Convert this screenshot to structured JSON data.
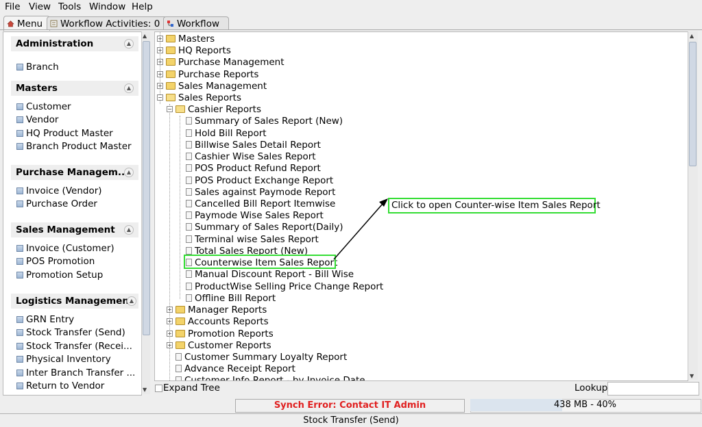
{
  "menubar": {
    "items": [
      "File",
      "View",
      "Tools",
      "Window",
      "Help"
    ]
  },
  "tabs": [
    {
      "label": "Menu",
      "icon": "home-icon"
    },
    {
      "label": "Workflow Activities: 0",
      "icon": "list-icon"
    },
    {
      "label": "Workflow",
      "icon": "workflow-icon"
    }
  ],
  "sidebar": {
    "groups": [
      {
        "title": "Administration",
        "items": [
          "Branch"
        ]
      },
      {
        "title": "Masters",
        "items": [
          "Customer",
          "Vendor",
          "HQ Product Master",
          "Branch Product Master"
        ]
      },
      {
        "title": "Purchase Managem...",
        "items": [
          "Invoice (Vendor)",
          "Purchase Order"
        ]
      },
      {
        "title": "Sales Management",
        "items": [
          "Invoice (Customer)",
          "POS Promotion",
          "Promotion Setup"
        ]
      },
      {
        "title": "Logistics Management",
        "items": [
          "GRN Entry",
          "Stock Transfer (Send)",
          "Stock Transfer (Recei...",
          "Physical Inventory",
          "Inter Branch Transfer ...",
          "Return to Vendor"
        ]
      }
    ]
  },
  "tree": {
    "top_folders": [
      "Masters",
      "HQ Reports",
      "Purchase Management",
      "Purchase Reports",
      "Sales Management",
      "Sales Reports"
    ],
    "sales_reports": {
      "cashier_folder": "Cashier Reports",
      "cashier_items": [
        "Summary of Sales Report (New)",
        "Hold Bill Report",
        "Billwise Sales Detail Report",
        "Cashier Wise Sales Report",
        "POS Product Refund Report",
        "POS Product Exchange Report",
        "Sales against Paymode Report",
        "Cancelled Bill Report Itemwise",
        "Paymode Wise Sales Report",
        "Summary of Sales Report(Daily)",
        "Terminal wise Sales Report",
        "Total Sales Report (New)",
        "Counterwise Item Sales Report",
        "Manual Discount Report - Bill Wise",
        "ProductWise Selling Price Change Report",
        "Offline Bill Report"
      ],
      "sub_folders": [
        "Manager Reports",
        "Accounts Reports",
        "Promotion Reports",
        "Customer Reports"
      ],
      "leaf_items": [
        "Customer Summary Loyalty Report",
        "Advance Receipt Report",
        "Customer Info Report - by Invoice Date"
      ]
    }
  },
  "callout": {
    "text": "Click to open Counter-wise Item Sales Report",
    "color": "#33dd33"
  },
  "bottom": {
    "expand_tree": "Expand Tree",
    "lookup_label": "Lookup",
    "status_text": "Synch Error: Contact IT Admin",
    "memory_text": "438 MB - 40%",
    "memory_fraction": 0.4,
    "footer_text": "Stock Transfer (Send)"
  }
}
